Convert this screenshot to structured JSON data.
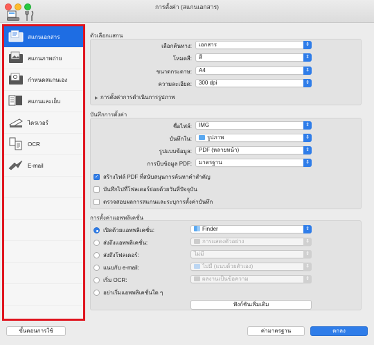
{
  "window": {
    "title": "การตั้งค่า (สแกนเอกสาร)"
  },
  "toolbar": {
    "icons": [
      "scan-settings-icon",
      "general-settings-icon"
    ]
  },
  "sidebar": {
    "items": [
      {
        "label": "สแกนเอกสาร",
        "icon": "document-scan-icon",
        "active": true
      },
      {
        "label": "สแกนภาพถ่าย",
        "icon": "photo-scan-icon",
        "active": false
      },
      {
        "label": "กำหนดสแกนเอง",
        "icon": "custom-scan-icon",
        "active": false
      },
      {
        "label": "สแกนและเย็บ",
        "icon": "scan-stitch-icon",
        "active": false
      },
      {
        "label": "ไดรเวอร์",
        "icon": "driver-icon",
        "active": false
      },
      {
        "label": "OCR",
        "icon": "ocr-icon",
        "active": false
      },
      {
        "label": "E-mail",
        "icon": "email-icon",
        "active": false
      }
    ],
    "highlight_color": "#e0141e",
    "active_color": "#1e6de3"
  },
  "scan_options": {
    "heading": "ตัวเลือกแสกน",
    "select_source": {
      "label": "เลือกต้นทาง:",
      "value": "เอกสาร"
    },
    "color_mode": {
      "label": "โหมดสี:",
      "value": "สี"
    },
    "paper_size": {
      "label": "ขนาดกระดาษ:",
      "value": "A4"
    },
    "resolution": {
      "label": "ความละเอียด:",
      "value": "300 dpi"
    },
    "image_processing": "การตั้งค่าการดำเนินการรูปภาพ"
  },
  "save_settings": {
    "heading": "บันทึกการตั้งค่า",
    "file_name": {
      "label": "ชื่อไฟล์:",
      "value": "IMG"
    },
    "save_in": {
      "label": "บันทึกใน:",
      "value": "รูปภาพ"
    },
    "data_format": {
      "label": "รูปแบบข้อมูล:",
      "value": "PDF (หลายหน้า)"
    },
    "pdf_compression": {
      "label": "การบีบข้อมูล PDF:",
      "value": "มาตรฐาน"
    },
    "checkboxes": [
      {
        "label": "สร้างไฟล์ PDF ที่สนับสนุนการค้นหาคำสำคัญ",
        "checked": true
      },
      {
        "label": "บันทึกไปที่โฟลเดอร์ย่อยด้วยวันที่ปัจจุบัน",
        "checked": false
      },
      {
        "label": "ตรวจสอบผลการสแกนและระบุการตั้งค่าบันทึก",
        "checked": false
      }
    ]
  },
  "app_settings": {
    "heading": "การตั้งค่าแอพพลิเคชั่น",
    "options": [
      {
        "label": "เปิดด้วยแอพพลิเคชั่น:",
        "value": "Finder",
        "selected": true,
        "icon": "finder-icon"
      },
      {
        "label": "ส่งถึงแอพพลิเคชั่น:",
        "value": "การแสดงตัวอย่าง",
        "selected": false,
        "icon": "preview-icon"
      },
      {
        "label": "ส่งถึงโฟลเดอร์:",
        "value": "ไม่มี",
        "selected": false,
        "icon": ""
      },
      {
        "label": "แนบกับ e-mail:",
        "value": "ไม่มี (แนบด้วยตัวเอง)",
        "selected": false,
        "icon": "folder-icon"
      },
      {
        "label": "เริ่ม OCR:",
        "value": "ผลงานเป็นข้อความ",
        "selected": false,
        "icon": "text-output-icon"
      },
      {
        "label": "อย่าเริ่มแอพพลิเคชั่นใด ๆ",
        "value": "",
        "selected": false,
        "icon": ""
      }
    ],
    "more_functions_button": "ฟังก์ชันเพิ่มเติม"
  },
  "footer": {
    "instructions_button": "ขั้นตอนการใช้",
    "defaults_button": "ค่ามาตรฐาน",
    "ok_button": "ตกลง"
  }
}
